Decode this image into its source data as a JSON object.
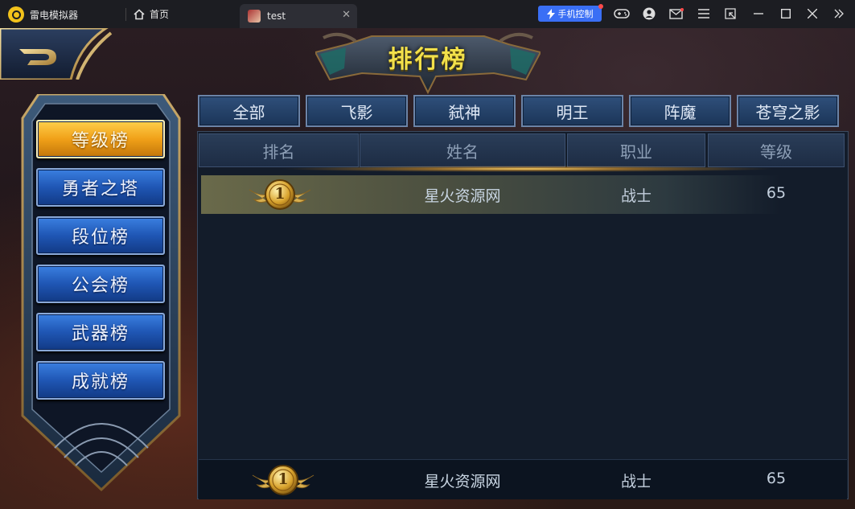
{
  "app": {
    "name": "雷电模拟器",
    "home_label": "首页",
    "tab_title": "test",
    "phone_control_label": "手机控制"
  },
  "game": {
    "banner_title": "排行榜",
    "left_menu": [
      {
        "label": "等级榜",
        "active": true
      },
      {
        "label": "勇者之塔",
        "active": false
      },
      {
        "label": "段位榜",
        "active": false
      },
      {
        "label": "公会榜",
        "active": false
      },
      {
        "label": "武器榜",
        "active": false
      },
      {
        "label": "成就榜",
        "active": false
      }
    ],
    "category_tabs": [
      "全部",
      "飞影",
      "弑神",
      "明王",
      "阵魔",
      "苍穹之影"
    ],
    "table": {
      "headers": [
        "排名",
        "姓名",
        "职业",
        "等级"
      ],
      "rows": [
        {
          "rank": "1",
          "name": "星火资源网",
          "class": "战士",
          "level": "65"
        }
      ],
      "self_row": {
        "rank": "1",
        "name": "星火资源网",
        "class": "战士",
        "level": "65"
      }
    }
  },
  "colors": {
    "menu_blue": "#1f56b4",
    "menu_gold": "#f0a018",
    "banner_yellow": "#f2e04a",
    "phone_control_blue": "#3a6ff5"
  }
}
